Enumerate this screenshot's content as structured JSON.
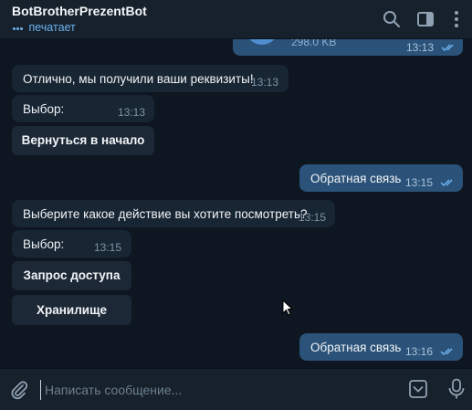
{
  "header": {
    "bot_name": "BotBrotherPrezentBot",
    "status": "печатает",
    "icons": [
      "search-icon",
      "sidebar-toggle-icon",
      "more-vertical-icon"
    ]
  },
  "messages": {
    "partial_file": {
      "size": "298.0 KB",
      "time": "13:13"
    },
    "received_1": {
      "text": "Отлично, мы получили ваши реквизиты!",
      "time": "13:13"
    },
    "choice_1": {
      "text": "Выбор:",
      "time": "13:13"
    },
    "button_back": "Вернуться в начало",
    "sent_1": {
      "text": "Обратная связь",
      "time": "13:15"
    },
    "received_2": {
      "text": "Выберите какое действие вы хотите посмотреть?",
      "time": "13:15"
    },
    "choice_2": {
      "text": "Выбор:",
      "time": "13:15"
    },
    "button_access": "Запрос доступа",
    "button_storage": "Хранилище",
    "sent_2": {
      "text": "Обратная связь",
      "time": "13:16"
    }
  },
  "composer": {
    "placeholder": "Написать сообщение...",
    "icons": [
      "attach-icon",
      "keyboard-toggle-icon",
      "microphone-icon"
    ]
  },
  "colors": {
    "background": "#0e1621",
    "header": "#17212b",
    "incoming_bubble": "#182533",
    "outgoing_bubble": "#2b5278",
    "accent": "#6cb2f2"
  }
}
